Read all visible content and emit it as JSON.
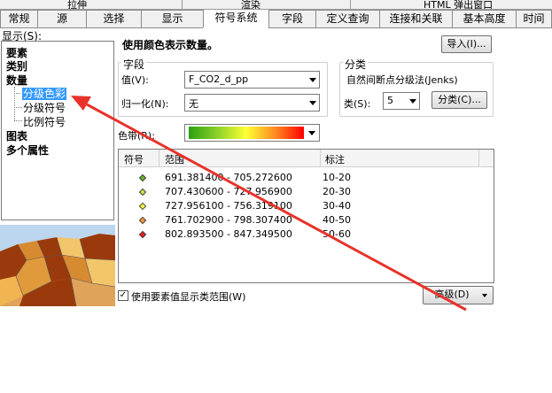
{
  "tabs_top": [
    "拉伸",
    "渲染",
    "HTML 弹出窗口"
  ],
  "tabs": [
    "常规",
    "源",
    "选择",
    "显示",
    "符号系统",
    "字段",
    "定义查询",
    "连接和关联",
    "基本高度",
    "时间"
  ],
  "active_tab": "符号系统",
  "show": {
    "label": "显示(S):",
    "tree": [
      "要素",
      "类别",
      "数量",
      "分级色彩",
      "分级符号",
      "比例符号",
      "图表",
      "多个属性"
    ]
  },
  "header": {
    "title": "使用颜色表示数量。",
    "import_button": "导入(I)..."
  },
  "fields": {
    "group_title": "字段",
    "value_label": "值(V):",
    "value": "F_CO2_d_pp",
    "normalize_label": "归一化(N):",
    "normalize_value": "无"
  },
  "classification": {
    "group_title": "分类",
    "method": "自然间断点分级法(Jenks)",
    "classes_label": "类(S):",
    "classes_value": "5",
    "classify_button": "分类(C)..."
  },
  "color_ramp": {
    "label": "色带(R):",
    "colors": [
      "#2aa10f",
      "#8cd12a",
      "#ffff33",
      "#ff8a22",
      "#ff0000"
    ]
  },
  "table": {
    "headers": [
      "符号",
      "范围",
      "标注"
    ],
    "rows": [
      {
        "color": "#66b32e",
        "range": "691.381400 - 705.272600",
        "label": "10-20"
      },
      {
        "color": "#c2e04a",
        "range": "707.430600 - 727.956900",
        "label": "20-30"
      },
      {
        "color": "#ffff40",
        "range": "727.956100 - 756.319100",
        "label": "30-40"
      },
      {
        "color": "#ff9a33",
        "range": "761.702900 - 798.307400",
        "label": "40-50"
      },
      {
        "color": "#ee1c1c",
        "range": "802.893500 - 847.349500",
        "label": "50-60"
      }
    ]
  },
  "footer": {
    "checkbox_label": "使用要素值显示类范围(W)",
    "checkbox_checked": "✓",
    "advanced_button": "高级(D)"
  },
  "annotation_color": "#e8322a"
}
